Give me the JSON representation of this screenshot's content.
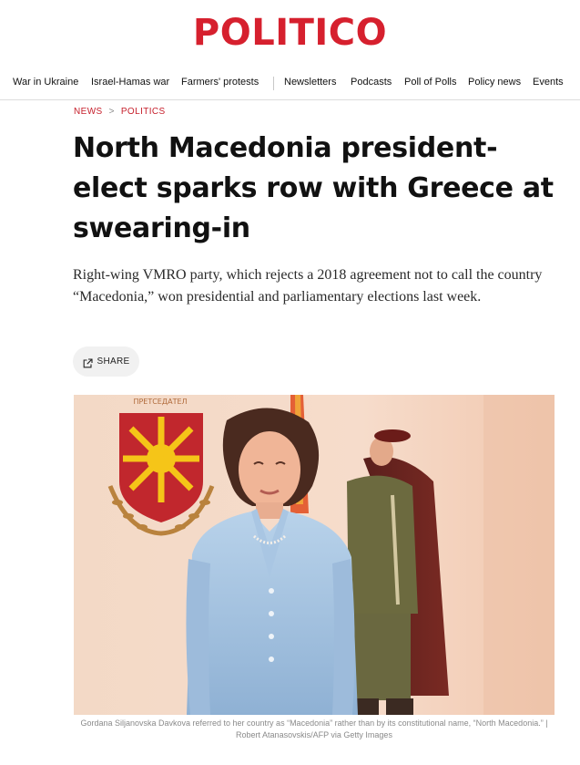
{
  "brand": {
    "name": "POLITICO"
  },
  "nav": {
    "items": [
      {
        "label": "War in Ukraine"
      },
      {
        "label": "Israel-Hamas war"
      },
      {
        "label": "Farmers' protests"
      },
      {
        "label": "Newsletters"
      },
      {
        "label": "Podcasts"
      },
      {
        "label": "Poll of Polls"
      },
      {
        "label": "Policy news"
      },
      {
        "label": "Events"
      }
    ]
  },
  "breadcrumb": {
    "items": [
      {
        "label": "NEWS"
      },
      {
        "label": "POLITICS"
      }
    ],
    "separator": ">"
  },
  "article": {
    "headline": "North Macedonia president-elect sparks row with Greece at swearing-in",
    "dek": "Right-wing VMRO party, which rejects a 2018 agreement not to call the country “Macedonia,” won presidential and parliamentary elections last week.",
    "share_label": "SHARE",
    "caption": "Gordana Siljanovska Davkova referred to her country as “Macedonia” rather than by its constitutional name, “North Macedonia.” | Robert Atanasovskis/AFP via Getty Images"
  },
  "photo": {
    "emblem_text": "ПРЕТСЕДАТЕЛ"
  },
  "colors": {
    "brand_red": "#d6202e",
    "breadcrumb_red": "#c6202c",
    "share_bg": "#f1f1f1",
    "caption_gray": "#8a8a8a"
  },
  "icons": {
    "share": "share-icon"
  }
}
